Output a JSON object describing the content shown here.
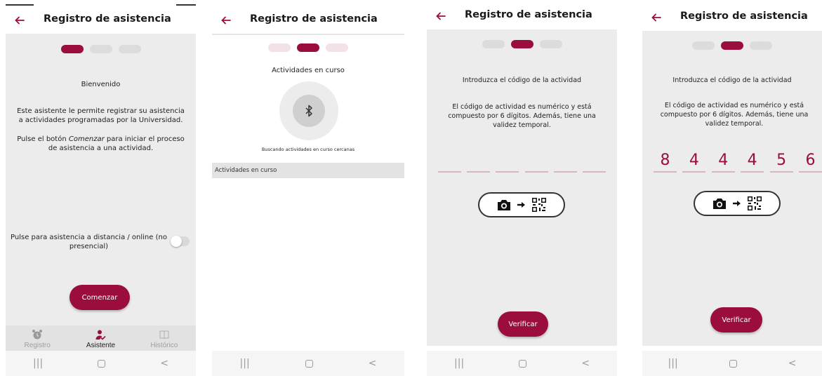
{
  "screens": [
    {
      "title": "Registro de asistencia",
      "welcome": "Bienvenido",
      "intro": "Este asistente le permite registrar su asistencia a actividades programadas por la Universidad.",
      "hint_before": "Pulse el botón ",
      "hint_emphasis": "Comenzar",
      "hint_after": " para iniciar el proceso de asistencia a una actividad.",
      "remote_label": "Pulse para asistencia a distancia / online (no presencial)",
      "remote_toggle_on": false,
      "start_button": "Comenzar",
      "nav": [
        {
          "label": "Registro",
          "icon": "alarm-clock-icon",
          "active": false
        },
        {
          "label": "Asistente",
          "icon": "person-check-icon",
          "active": true
        },
        {
          "label": "Histórico",
          "icon": "book-icon",
          "active": false
        }
      ],
      "progress_step": 1
    },
    {
      "title": "Registro de asistencia",
      "heading": "Actividades en curso",
      "scanning_text": "Buscando actividades en curso cercanas",
      "section_label": "Actividades en curso",
      "progress_step": 2
    },
    {
      "title": "Registro de asistencia",
      "prompt": "Introduzca el código de la actividad",
      "description": "El código de actividad es numérico y está compuesto por 6 dígitos. Además, tiene una validez temporal.",
      "code_digits": [
        "",
        "",
        "",
        "",
        "",
        ""
      ],
      "verify_button": "Verificar",
      "progress_step": 2
    },
    {
      "title": "Registro de asistencia",
      "prompt": "Introduzca el código de la actividad",
      "description": "El código de actividad es numérico y está compuesto por 6 dígitos. Además, tiene una validez temporal.",
      "code_digits": [
        "8",
        "4",
        "4",
        "4",
        "5",
        "6"
      ],
      "verify_button": "Verificar",
      "progress_step": 2
    }
  ],
  "system_nav": {
    "recent": "|||",
    "back": "<"
  },
  "colors": {
    "accent": "#9b0d3c",
    "background": "#ececec",
    "code_underline": "#d7b6c1"
  }
}
